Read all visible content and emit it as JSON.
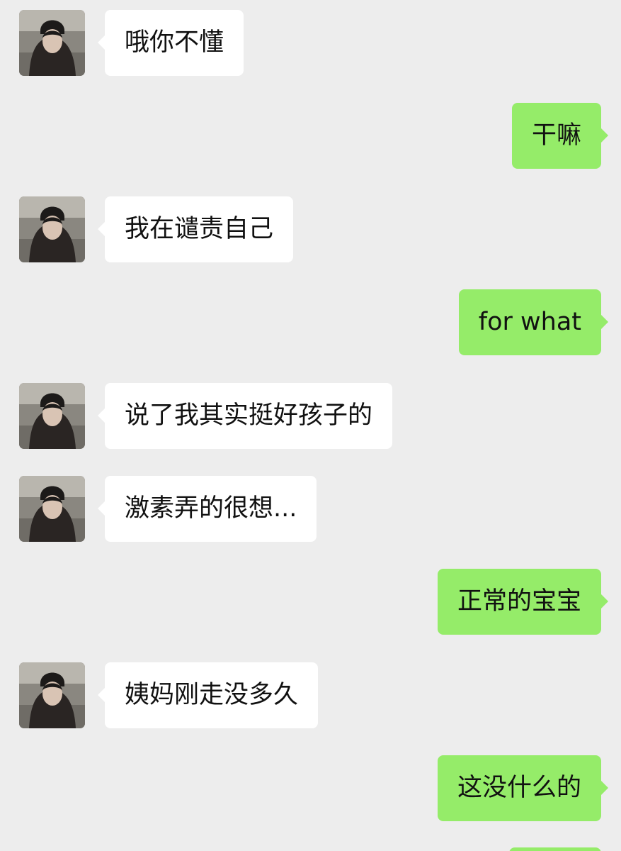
{
  "colors": {
    "background": "#ededed",
    "incoming_bubble": "#ffffff",
    "outgoing_bubble": "#95ec69",
    "text": "#111111"
  },
  "messages": [
    {
      "direction": "in",
      "text": "哦你不懂",
      "avatar": "avatar-photo"
    },
    {
      "direction": "out",
      "text": "干嘛"
    },
    {
      "direction": "in",
      "text": "我在谴责自己",
      "avatar": "avatar-photo"
    },
    {
      "direction": "out",
      "text": "for what"
    },
    {
      "direction": "in",
      "text": "说了我其实挺好孩子的",
      "avatar": "avatar-photo"
    },
    {
      "direction": "in",
      "text": "激素弄的很想...",
      "avatar": "avatar-photo"
    },
    {
      "direction": "out",
      "text": "正常的宝宝"
    },
    {
      "direction": "in",
      "text": "姨妈刚走没多久",
      "avatar": "avatar-photo"
    },
    {
      "direction": "out",
      "text": "这没什么的"
    }
  ]
}
